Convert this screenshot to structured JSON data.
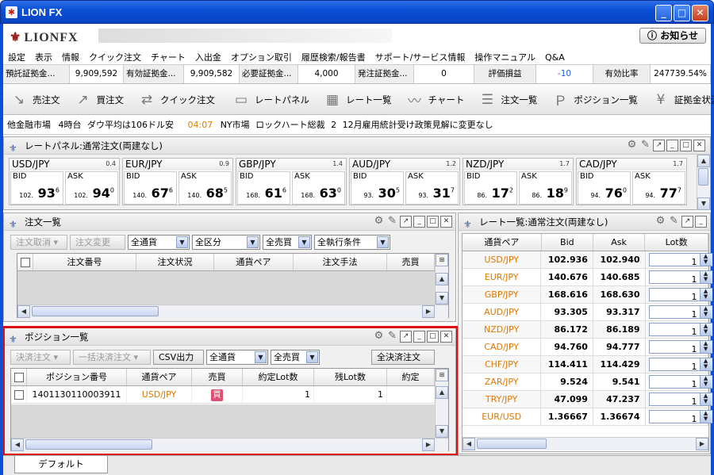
{
  "window": {
    "title": "LION FX"
  },
  "logo": {
    "text": "LIONFX"
  },
  "notice_button": "お知らせ",
  "menu": [
    "設定",
    "表示",
    "情報",
    "クイック注文",
    "チャート",
    "入出金",
    "オプション取引",
    "履歴検索/報告書",
    "サポート/サービス情報",
    "操作マニュアル",
    "Q&A"
  ],
  "status": [
    {
      "label": "預託証拠金...",
      "value": "9,909,592"
    },
    {
      "label": "有効証拠金...",
      "value": "9,909,582"
    },
    {
      "label": "必要証拠金...",
      "value": "4,000"
    },
    {
      "label": "発注証拠金...",
      "value": "0"
    },
    {
      "label": "評価損益",
      "value": "-10"
    },
    {
      "label": "有効比率",
      "value": "247739.54%"
    }
  ],
  "toolbar": [
    "売注文",
    "買注文",
    "クイック注文",
    "レートパネル",
    "レート一覧",
    "チャート",
    "注文一覧",
    "ポジション一覧",
    "証拠金状況"
  ],
  "ticker": {
    "source": "他金融市場",
    "t1": "4時台",
    "h1": "ダウ平均は106ドル安",
    "time": "04:07",
    "h2": "NY市場",
    "h3": "ロックハート総裁",
    "h4": "2",
    "h5": "12月雇用統計受け政策見解に変更なし"
  },
  "rate_panel": {
    "title": "レートパネル:通常注文(両建なし)",
    "pairs": [
      {
        "pair": "USD/JPY",
        "spread": "0.4",
        "bid_pre": "102.",
        "bid_big": "93",
        "bid_small": "6",
        "ask_pre": "102.",
        "ask_big": "94",
        "ask_small": "0"
      },
      {
        "pair": "EUR/JPY",
        "spread": "0.9",
        "bid_pre": "140.",
        "bid_big": "67",
        "bid_small": "6",
        "ask_pre": "140.",
        "ask_big": "68",
        "ask_small": "5"
      },
      {
        "pair": "GBP/JPY",
        "spread": "1.4",
        "bid_pre": "168.",
        "bid_big": "61",
        "bid_small": "6",
        "ask_pre": "168.",
        "ask_big": "63",
        "ask_small": "0"
      },
      {
        "pair": "AUD/JPY",
        "spread": "1.2",
        "bid_pre": "93.",
        "bid_big": "30",
        "bid_small": "5",
        "ask_pre": "93.",
        "ask_big": "31",
        "ask_small": "7"
      },
      {
        "pair": "NZD/JPY",
        "spread": "1.7",
        "bid_pre": "86.",
        "bid_big": "17",
        "bid_small": "2",
        "ask_pre": "86.",
        "ask_big": "18",
        "ask_small": "9"
      },
      {
        "pair": "CAD/JPY",
        "spread": "1.7",
        "bid_pre": "94.",
        "bid_big": "76",
        "bid_small": "0",
        "ask_pre": "94.",
        "ask_big": "77",
        "ask_small": "7"
      }
    ],
    "bid_label": "BID",
    "ask_label": "ASK"
  },
  "order_list": {
    "title": "注文一覧",
    "buttons": [
      "注文取消",
      "注文変更"
    ],
    "filters": [
      "全通貨",
      "全区分",
      "全売買",
      "全執行条件"
    ],
    "columns": [
      "注文番号",
      "注文状況",
      "通貨ペア",
      "注文手法",
      "売買"
    ]
  },
  "position_list": {
    "title": "ポジション一覧",
    "buttons": [
      "決済注文",
      "一括決済注文",
      "CSV出力"
    ],
    "filters": [
      "全通貨",
      "全売買"
    ],
    "all_settle": "全決済注文",
    "columns": [
      "ポジション番号",
      "通貨ペア",
      "売買",
      "約定Lot数",
      "残Lot数",
      "約定"
    ],
    "rows": [
      {
        "id": "1401130110003911",
        "pair": "USD/JPY",
        "side": "買",
        "lot": "1",
        "remain": "1"
      }
    ]
  },
  "rate_list": {
    "title": "レート一覧:通常注文(両建なし)",
    "columns": [
      "通貨ペア",
      "Bid",
      "Ask",
      "Lot数"
    ],
    "rows": [
      {
        "pair": "USD/JPY",
        "bid": "102.936",
        "ask": "102.940",
        "lot": "1"
      },
      {
        "pair": "EUR/JPY",
        "bid": "140.676",
        "ask": "140.685",
        "lot": "1"
      },
      {
        "pair": "GBP/JPY",
        "bid": "168.616",
        "ask": "168.630",
        "lot": "1"
      },
      {
        "pair": "AUD/JPY",
        "bid": "93.305",
        "ask": "93.317",
        "lot": "1"
      },
      {
        "pair": "NZD/JPY",
        "bid": "86.172",
        "ask": "86.189",
        "lot": "1"
      },
      {
        "pair": "CAD/JPY",
        "bid": "94.760",
        "ask": "94.777",
        "lot": "1"
      },
      {
        "pair": "CHF/JPY",
        "bid": "114.411",
        "ask": "114.429",
        "lot": "1"
      },
      {
        "pair": "ZAR/JPY",
        "bid": "9.524",
        "ask": "9.541",
        "lot": "1"
      },
      {
        "pair": "TRY/JPY",
        "bid": "47.099",
        "ask": "47.237",
        "lot": "1"
      },
      {
        "pair": "EUR/USD",
        "bid": "1.36667",
        "ask": "1.36674",
        "lot": "1"
      }
    ]
  },
  "bottom_tab": "デフォルト",
  "colors": {
    "titlebar": "#0a4fd6",
    "accent_orange": "#e07800",
    "highlight": "#e01010",
    "negative": "#2060e0"
  }
}
